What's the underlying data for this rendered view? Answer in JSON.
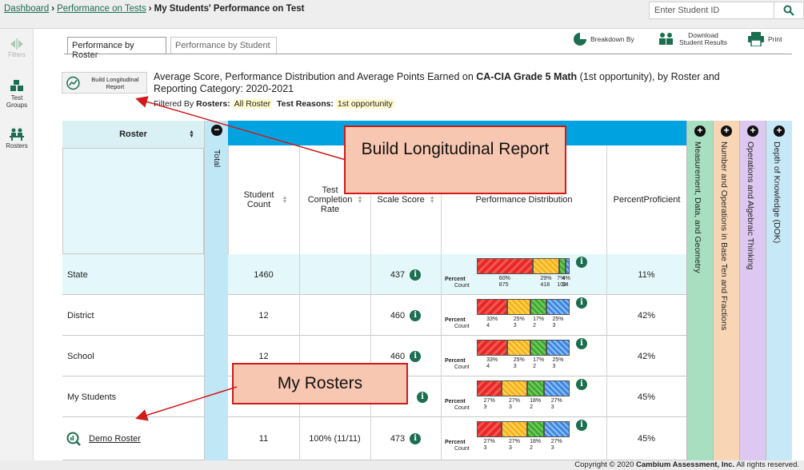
{
  "breadcrumb": {
    "dashboard": "Dashboard",
    "performance_on_tests": "Performance on Tests",
    "current": "My Students' Performance on Test",
    "separator": "›"
  },
  "search": {
    "placeholder": "Enter Student ID",
    "icon": "magnifier-icon"
  },
  "leftnav": {
    "filters": "Filters",
    "test_groups": "Test Groups",
    "rosters": "Rosters"
  },
  "tabs": [
    {
      "label": "Performance by Roster",
      "active": true
    },
    {
      "label": "Performance by Student",
      "active": false
    }
  ],
  "toolbar": {
    "breakdown": "Breakdown By",
    "download_line1": "Download",
    "download_line2": "Student Results",
    "print": "Print"
  },
  "report": {
    "lr_button": "Build Longitudinal Report",
    "title_pre": "Average Score, Performance Distribution and Average Points Earned on ",
    "title_test": "CA-CIA Grade 5 Math",
    "title_post": " (1st opportunity), by Roster and Reporting Category: 2020-2021",
    "filtered_by": "Filtered By",
    "rosters_label": "Rosters:",
    "rosters_value": "All Roster",
    "reasons_label": "Test Reasons:",
    "reasons_value": "1st opportunity"
  },
  "table": {
    "roster_header": "Roster",
    "total_label": "Total",
    "columns": {
      "student_count": "Student Count",
      "completion": "Test Completion Rate",
      "scale_score": "Scale Score",
      "perf_dist": "Performance Distribution",
      "percent_prof": "PercentProficient"
    },
    "pd_percent_label": "Percent",
    "pd_count_label": "Count",
    "rows": [
      {
        "name": "State",
        "count": "1460",
        "completion": "",
        "score": "437",
        "percents": [
          "60%",
          "29%",
          "7%",
          "4%"
        ],
        "counts": [
          "875",
          "418",
          "103",
          "64"
        ],
        "shares": [
          0.6,
          0.29,
          0.07,
          0.04
        ],
        "proficient": "11%"
      },
      {
        "name": "District",
        "count": "12",
        "completion": "",
        "score": "460",
        "percents": [
          "33%",
          "25%",
          "17%",
          "25%"
        ],
        "counts": [
          "4",
          "3",
          "2",
          "3"
        ],
        "shares": [
          0.33,
          0.25,
          0.17,
          0.25
        ],
        "proficient": "42%"
      },
      {
        "name": "School",
        "count": "12",
        "completion": "",
        "score": "460",
        "percents": [
          "33%",
          "25%",
          "17%",
          "25%"
        ],
        "counts": [
          "4",
          "3",
          "2",
          "3"
        ],
        "shares": [
          0.33,
          0.25,
          0.17,
          0.25
        ],
        "proficient": "42%"
      },
      {
        "name": "My Students",
        "count": "",
        "completion": "",
        "score": "",
        "percents": [
          "27%",
          "27%",
          "18%",
          "27%"
        ],
        "counts": [
          "3",
          "3",
          "2",
          "3"
        ],
        "shares": [
          0.27,
          0.27,
          0.18,
          0.28
        ],
        "proficient": "45%"
      },
      {
        "name": "Demo Roster",
        "count": "11",
        "completion": "100% (11/11)",
        "score": "473",
        "percents": [
          "27%",
          "27%",
          "18%",
          "27%"
        ],
        "counts": [
          "3",
          "3",
          "2",
          "3"
        ],
        "shares": [
          0.27,
          0.27,
          0.18,
          0.28
        ],
        "proficient": "45%"
      }
    ],
    "categories": [
      {
        "label": "Measurement, Data, and Geometry",
        "color": "#a8dfc0"
      },
      {
        "label": "Number and Operations in Base Ten and Fractions",
        "color": "#f8d6b5"
      },
      {
        "label": "Operations and Algebraic Thinking",
        "color": "#dcc8f0"
      },
      {
        "label": "Depth of Knowledge (DOK)",
        "color": "#c7e8f6"
      }
    ]
  },
  "callouts": {
    "longitudinal": "Build Longitudinal Report",
    "rosters": "My Rosters"
  },
  "footer": {
    "pre": "Copyright © 2020 ",
    "company": "Cambium Assessment, Inc.",
    "post": " All rights reserved."
  },
  "colors": {
    "brand_green": "#1b6e4f",
    "header_blue": "#00a3e0",
    "callout_border": "#d11a1a",
    "callout_fill": "#f8c7b1"
  }
}
